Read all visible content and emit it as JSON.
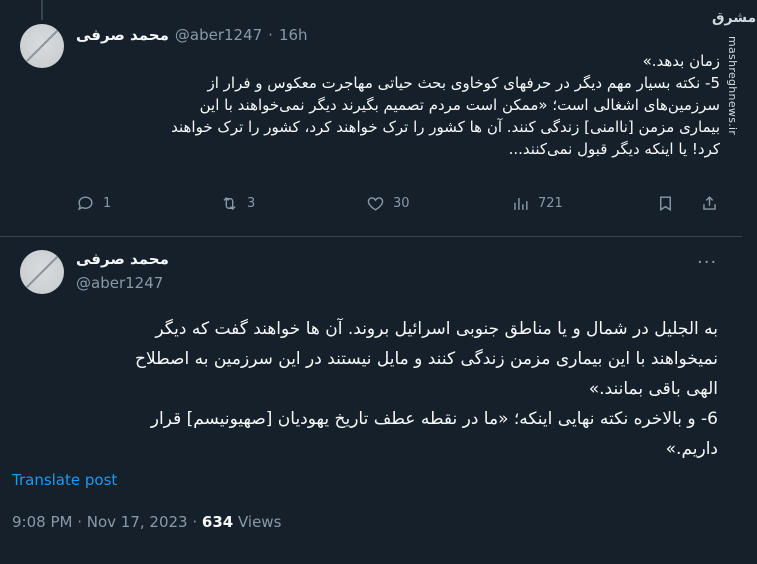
{
  "tweet1": {
    "name": "محمد صرفی",
    "handle": "@aber1247",
    "time": "16h",
    "lines": [
      "زمان بدهد.»",
      "5- نکته بسیار مهم دیگر در حرفهای کوخاوی بحث حیاتی مهاجرت معکوس و فرار از",
      "سرزمین‌های اشغالی است؛ «ممکن است مردم تصمیم بگیرند دیگر نمی‌خواهند با این",
      "بیماری مزمن [ناامنی] زندگی کنند. آن ها کشور را ترک خواهند کرد، کشور را ترک خواهند",
      "کرد! یا اینکه دیگر قبول نمی‌کنند..."
    ],
    "replies": "1",
    "reposts": "3",
    "likes": "30",
    "views": "721"
  },
  "tweet2": {
    "name": "محمد صرفی",
    "handle": "@aber1247",
    "lines": [
      "به الجلیل در شمال و یا مناطق جنوبی اسرائیل بروند. آن ها خواهند گفت که دیگر",
      "نمیخواهند با این بیماری مزمن زندگی کنند و مایل نیستند در این سرزمین به اصطلاح",
      "الهی باقی بمانند.»",
      "6- و بالاخره نکته نهایی اینکه؛ «ما در نقطه عطف تاریخ یهودیان [صهیونیسم] قرار",
      "داریم.»"
    ],
    "translate_label": "Translate post",
    "timestamp": "9:08 PM · Nov 17, 2023 · ",
    "views_count": "634",
    "views_label": " Views"
  },
  "watermark": {
    "logo": "مشرق",
    "url": "mashreghnews.ir"
  },
  "colors": {
    "background": "#15202b",
    "text": "#f7f9f9",
    "muted": "#8b98a5",
    "link": "#1d9bf0",
    "divider": "#38444d"
  },
  "icons": [
    "reply-icon",
    "repost-icon",
    "like-icon",
    "views-icon",
    "bookmark-icon",
    "share-icon",
    "more-icon"
  ]
}
